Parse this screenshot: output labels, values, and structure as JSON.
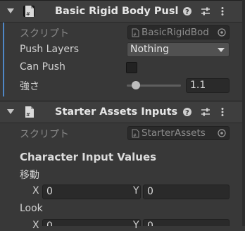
{
  "colors": {
    "panel_bg": "#383838",
    "field_bg": "#2a2a2a",
    "accent": "#4f87c7"
  },
  "component1": {
    "title": "Basic Rigid Body Pusl",
    "icons": [
      "help-icon",
      "presets-icon",
      "menu-icon"
    ],
    "script_label": "スクリプト",
    "script_value": "BasicRigidBod",
    "push_layers_label": "Push Layers",
    "push_layers_value": "Nothing",
    "can_push_label": "Can Push",
    "can_push_checked": false,
    "strength_label": "強さ",
    "strength_value": "1.1"
  },
  "component2": {
    "title": "Starter Assets Inputs",
    "icons": [
      "help-icon",
      "presets-icon",
      "menu-icon"
    ],
    "script_label": "スクリプト",
    "script_value": "StarterAssets",
    "section_title": "Character Input Values",
    "move_label": "移動",
    "move_x_label": "X",
    "move_x_value": "0",
    "move_y_label": "Y",
    "move_y_value": "0",
    "look_label": "Look",
    "look_x_label": "X",
    "look_x_value": "0",
    "look_y_label": "Y",
    "look_y_value": "0"
  }
}
